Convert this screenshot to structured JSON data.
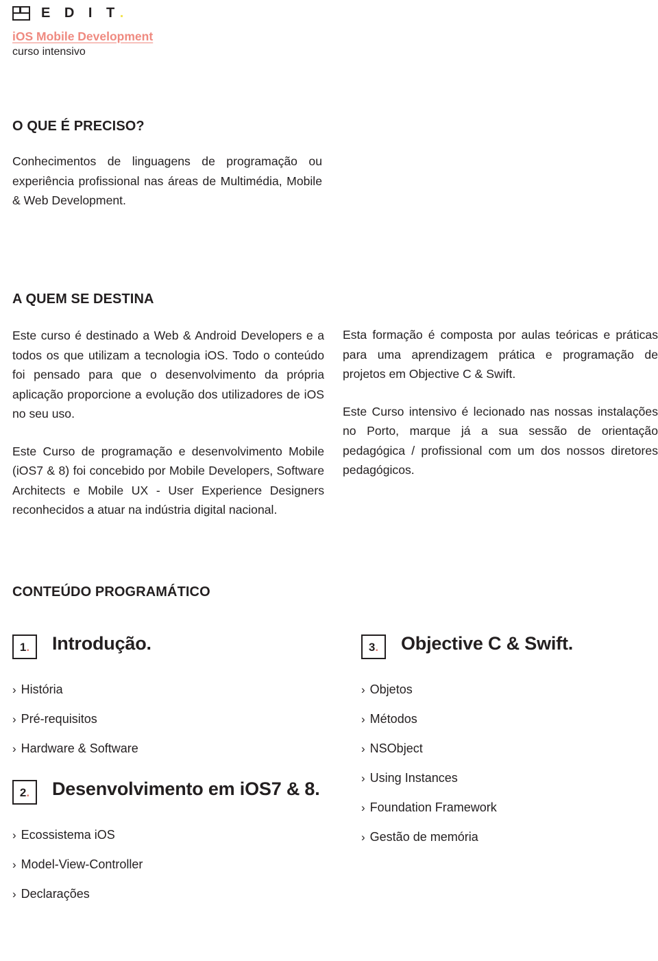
{
  "header": {
    "logo_icon": "edit-grid-logo-icon",
    "logo_text": "E D I T",
    "logo_dot": ".",
    "course_title": "iOS Mobile Development",
    "course_subtitle": "curso intensivo",
    "title_color": "#ef8a80",
    "dot_color": "#f2e34c"
  },
  "requisitos": {
    "heading": "O QUE É PRECISO?",
    "body": "Conhecimentos de linguagens de programação ou experiência profissional nas áreas de Multimédia, Mobile & Web Development."
  },
  "destina": {
    "heading": "A QUEM SE DESTINA",
    "paragraph_1": "Este curso é destinado a Web & Android Developers e a todos os que utilizam a tecnologia iOS. Todo o conteúdo foi pensado para que o desenvolvimento da própria aplicação proporcione a evolução dos utilizadores de iOS no seu uso.",
    "paragraph_2": "Este Curso de programação e desenvolvimento Mobile (iOS7 & 8) foi concebido por Mobile Developers, Software Architects e Mobile UX - User Experience Designers reconhecidos a atuar na indústria digital nacional."
  },
  "right_column": {
    "paragraph_1": "Esta formação é composta por aulas teóricas e práticas para uma aprendizagem prática e programação de projetos em Objective C & Swift.",
    "paragraph_2": "Este Curso intensivo é lecionado nas nossas instalações no Porto, marque já a sua sessão de orientação pedagógica / profissional com um dos nossos diretores pedagógicos."
  },
  "programa": {
    "heading": "CONTEÚDO PROGRAMÁTICO",
    "bullet_glyph": "›",
    "modules": [
      {
        "number": "1",
        "number_dot": ".",
        "title": "Introdução.",
        "items": [
          "História",
          "Pré-requisitos",
          "Hardware & Software"
        ]
      },
      {
        "number": "2",
        "number_dot": ".",
        "title": "Desenvolvimento em iOS7 & 8.",
        "items": [
          "Ecossistema iOS",
          "Model-View-Controller",
          "Declarações"
        ]
      },
      {
        "number": "3",
        "number_dot": ".",
        "title": "Objective C & Swift.",
        "items": [
          "Objetos",
          "Métodos",
          "NSObject",
          "Using Instances",
          "Foundation Framework",
          "Gestão de memória"
        ]
      }
    ]
  }
}
